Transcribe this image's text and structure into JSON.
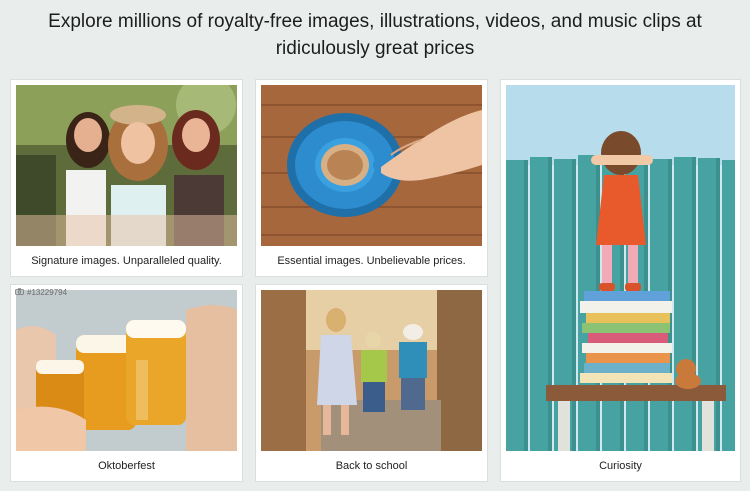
{
  "headline": "Explore millions of royalty-free images, illustrations, videos, and music clips at ridiculously great prices",
  "cards": {
    "friends": {
      "caption": "Signature images. Unparalleled quality."
    },
    "coffee": {
      "caption": "Essential images. Unbelievable prices."
    },
    "curiosity": {
      "caption": "Curiosity"
    },
    "oktoberfest": {
      "caption": "Oktoberfest",
      "image_id": "#13229794",
      "badge_icon": "camera-icon"
    },
    "school": {
      "caption": "Back to school"
    }
  },
  "colors": {
    "page_bg": "#e9eeed",
    "card_bg": "#ffffff",
    "caption_text": "#222222"
  }
}
